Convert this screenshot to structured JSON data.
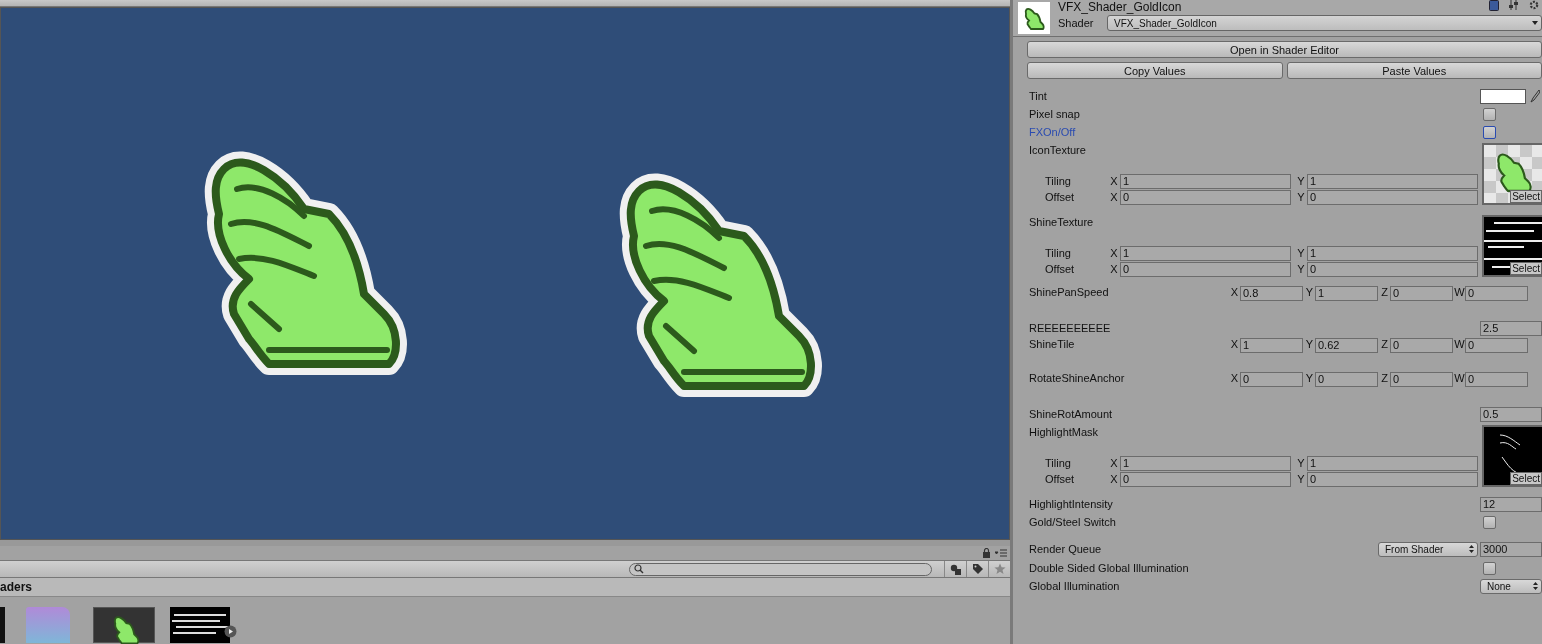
{
  "inspector": {
    "title": "VFX_Shader_GoldIcon",
    "shader_label": "Shader",
    "shader_value": "VFX_Shader_GoldIcon",
    "buttons": [
      {
        "label": "Open in Shader Editor"
      },
      {
        "label": "Copy Values"
      },
      {
        "label": "Paste Values"
      }
    ],
    "properties": [
      {
        "kind": "color",
        "label": "Tint"
      },
      {
        "kind": "toggle",
        "label": "Pixel snap",
        "checked": false,
        "highlighted": false
      },
      {
        "kind": "toggle",
        "label": "FXOn/Off",
        "checked": false,
        "highlighted": true
      },
      {
        "kind": "texture",
        "label": "IconTexture",
        "preview": {
          "kind": "icon"
        },
        "select": "Select",
        "tiling": {
          "label": "Tiling",
          "fields": [
            {
              "axis": "X",
              "value": "1"
            },
            {
              "axis": "Y",
              "value": "1"
            }
          ]
        },
        "offset": {
          "label": "Offset",
          "fields": [
            {
              "axis": "X",
              "value": "0"
            },
            {
              "axis": "Y",
              "value": "0"
            }
          ]
        }
      },
      {
        "kind": "texture",
        "label": "ShineTexture",
        "preview": {
          "kind": "streaks"
        },
        "select": "Select",
        "tiling": {
          "label": "Tiling",
          "fields": [
            {
              "axis": "X",
              "value": "1"
            },
            {
              "axis": "Y",
              "value": "1"
            }
          ]
        },
        "offset": {
          "label": "Offset",
          "fields": [
            {
              "axis": "X",
              "value": "0"
            },
            {
              "axis": "Y",
              "value": "0"
            }
          ]
        }
      },
      {
        "kind": "vector",
        "label": "ShinePanSpeed",
        "fields": [
          {
            "axis": "X",
            "value": "0.8"
          },
          {
            "axis": "Y",
            "value": "1"
          },
          {
            "axis": "Z",
            "value": "0"
          },
          {
            "axis": "W",
            "value": "0"
          }
        ]
      },
      {
        "kind": "float",
        "label": "REEEEEEEEEE",
        "value": "2.5"
      },
      {
        "kind": "vector",
        "label": "ShineTile",
        "fields": [
          {
            "axis": "X",
            "value": "1"
          },
          {
            "axis": "Y",
            "value": "0.62"
          },
          {
            "axis": "Z",
            "value": "0"
          },
          {
            "axis": "W",
            "value": "0"
          }
        ]
      },
      {
        "kind": "vector",
        "label": "RotateShineAnchor",
        "fields": [
          {
            "axis": "X",
            "value": "0"
          },
          {
            "axis": "Y",
            "value": "0"
          },
          {
            "axis": "Z",
            "value": "0"
          },
          {
            "axis": "W",
            "value": "0"
          }
        ]
      },
      {
        "kind": "float",
        "label": "ShineRotAmount",
        "value": "0.5"
      },
      {
        "kind": "texture",
        "label": "HighlightMask",
        "preview": {
          "kind": "mask"
        },
        "select": "Select",
        "tiling": {
          "label": "Tiling",
          "fields": [
            {
              "axis": "X",
              "value": "1"
            },
            {
              "axis": "Y",
              "value": "1"
            }
          ]
        },
        "offset": {
          "label": "Offset",
          "fields": [
            {
              "axis": "X",
              "value": "0"
            },
            {
              "axis": "Y",
              "value": "0"
            }
          ]
        }
      },
      {
        "kind": "float",
        "label": "HighlightIntensity",
        "value": "12"
      },
      {
        "kind": "toggle",
        "label": "Gold/Steel Switch",
        "checked": false,
        "highlighted": false
      },
      {
        "kind": "render_queue",
        "label": "Render Queue",
        "dropdown": "From Shader",
        "value": "3000"
      },
      {
        "kind": "toggle",
        "label": "Double Sided Global Illumination",
        "checked": false,
        "highlighted": false
      },
      {
        "kind": "dropdown",
        "label": "Global Illumination",
        "value": "None"
      }
    ]
  },
  "project": {
    "breadcrumb": "aders"
  }
}
